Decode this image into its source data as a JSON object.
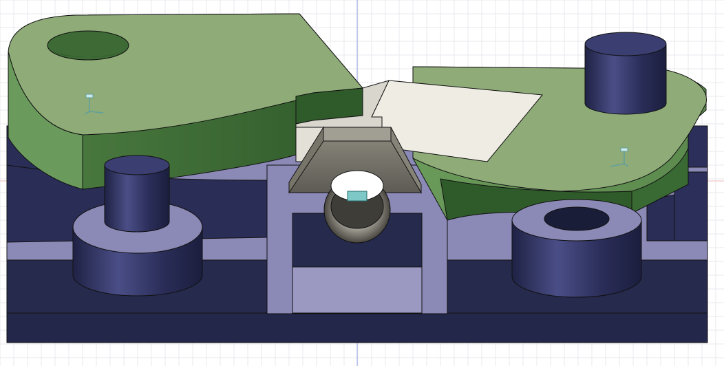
{
  "viewport": {
    "background": "#ffffff",
    "grid_color": "#e8e8ef",
    "axis_color": "#9aa6e6",
    "axis_color_red": "#f2b7b7"
  },
  "model": {
    "colors": {
      "base_top": "#8e8cb7",
      "base_front": "#262a4c",
      "base_dark": "#1f2342",
      "cylinder_side": "#2b2f58",
      "cylinder_top": "#3b3e70",
      "cam_top": "#8eab78",
      "cam_side": "#3e6b36",
      "cam_side_light": "#5f8d52",
      "plate": "#eeebe3",
      "wedge": "#6a6a62",
      "wedge_light": "#9a9a90",
      "ring": "#5b5952"
    },
    "icons": [
      "origin-axis-icon-left",
      "origin-axis-icon-right",
      "origin-axis-icon-center"
    ]
  }
}
